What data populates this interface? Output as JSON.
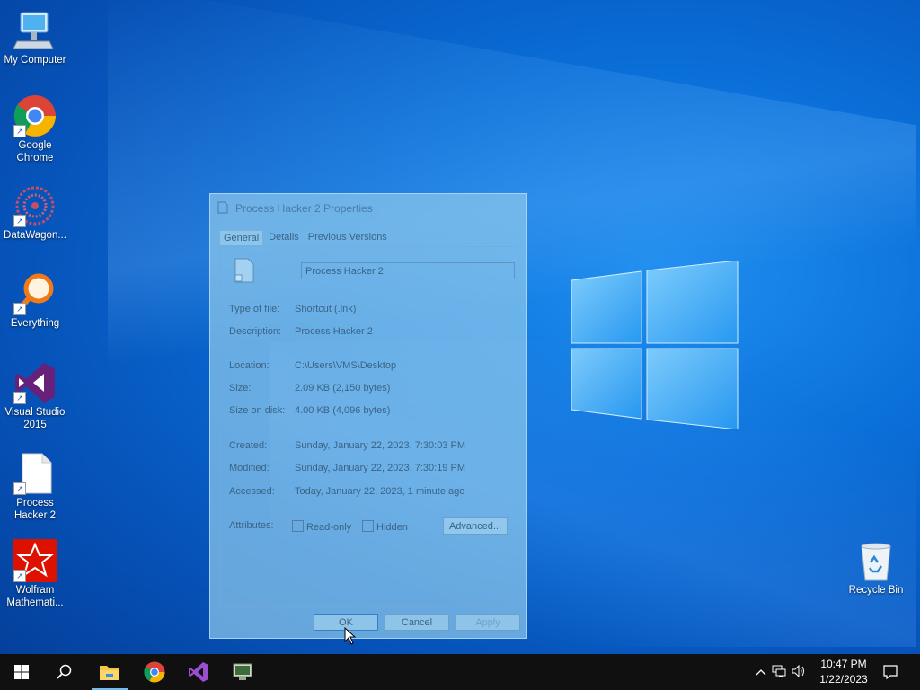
{
  "desktop": {
    "icons": [
      {
        "label": "My Computer"
      },
      {
        "label": "Google Chrome"
      },
      {
        "label": "DataWagon..."
      },
      {
        "label": "Everything"
      },
      {
        "label": "Visual Studio 2015"
      },
      {
        "label": "Process Hacker 2"
      },
      {
        "label": "Wolfram Mathemati..."
      },
      {
        "label": "Recycle Bin"
      }
    ]
  },
  "dialog": {
    "title": "Process Hacker 2 Properties",
    "tabs": [
      "General",
      "Details",
      "Previous Versions"
    ],
    "name": "Process Hacker 2",
    "fields": {
      "type_label": "Type of file:",
      "type_value": "Shortcut (.lnk)",
      "desc_label": "Description:",
      "desc_value": "Process Hacker 2",
      "loc_label": "Location:",
      "loc_value": "C:\\Users\\VMS\\Desktop",
      "size_label": "Size:",
      "size_value": "2.09 KB (2,150 bytes)",
      "disk_label": "Size on disk:",
      "disk_value": "4.00 KB (4,096 bytes)",
      "created_label": "Created:",
      "created_value": "Sunday, January 22, 2023, 7:30:03 PM",
      "modified_label": "Modified:",
      "modified_value": "Sunday, January 22, 2023, 7:30:19 PM",
      "accessed_label": "Accessed:",
      "accessed_value": "Today, January 22, 2023, 1 minute ago",
      "attr_label": "Attributes:"
    },
    "attributes": {
      "readonly": "Read-only",
      "hidden": "Hidden",
      "advanced": "Advanced..."
    },
    "buttons": {
      "ok": "OK",
      "cancel": "Cancel",
      "apply": "Apply"
    }
  },
  "taskbar": {
    "clock_time": "10:47 PM",
    "clock_date": "1/22/2023"
  },
  "colors": {
    "taskbar": "#101010",
    "accent": "#76b9ed"
  }
}
